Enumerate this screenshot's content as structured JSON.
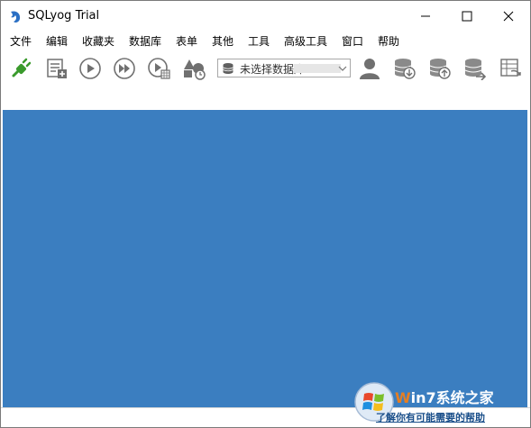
{
  "window": {
    "title": "SQLyog Trial"
  },
  "menu": {
    "items": [
      "文件",
      "编辑",
      "收藏夹",
      "数据库",
      "表单",
      "其他",
      "工具",
      "高级工具",
      "窗口",
      "帮助"
    ]
  },
  "toolbar": {
    "buttons": [
      "new-connection-icon",
      "new-query-editor-icon",
      "execute-query-icon",
      "execute-all-queries-icon",
      "execute-and-edit-icon",
      "create-object-icon",
      "user-manager-icon",
      "backup-database-icon",
      "restore-database-icon",
      "copy-database-icon",
      "schema-sync-icon"
    ],
    "database_select": {
      "value": "未选择数据库"
    }
  },
  "status": {
    "text": "了解你有可能需要的帮助"
  },
  "watermark": {
    "text": "Win7系统之家"
  },
  "colors": {
    "main_background": "#3b7ec0",
    "accent_green": "#3a9a2c"
  }
}
